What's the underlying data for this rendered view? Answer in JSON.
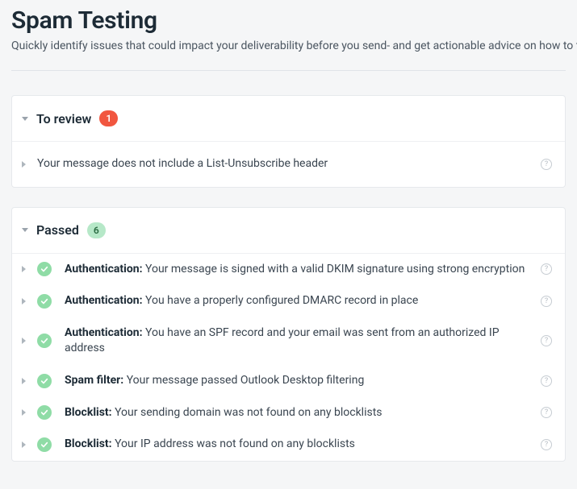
{
  "header": {
    "title": "Spam Testing",
    "description": "Quickly identify issues that could impact your deliverability before you send- and get actionable advice on how to fi"
  },
  "sections": {
    "review": {
      "title": "To review",
      "count": "1",
      "items": [
        {
          "text": "Your message does not include a List-Unsubscribe header"
        }
      ]
    },
    "passed": {
      "title": "Passed",
      "count": "6",
      "items": [
        {
          "label": "Authentication:",
          "text": "Your message is signed with a valid DKIM signature using strong encryption"
        },
        {
          "label": "Authentication:",
          "text": "You have a properly configured DMARC record in place"
        },
        {
          "label": "Authentication:",
          "text": "You have an SPF record and your email was sent from an authorized IP address"
        },
        {
          "label": "Spam filter:",
          "text": "Your message passed Outlook Desktop filtering"
        },
        {
          "label": "Blocklist:",
          "text": "Your sending domain was not found on any blocklists"
        },
        {
          "label": "Blocklist:",
          "text": "Your IP address was not found on any blocklists"
        }
      ]
    }
  },
  "glyphs": {
    "help": "?"
  }
}
